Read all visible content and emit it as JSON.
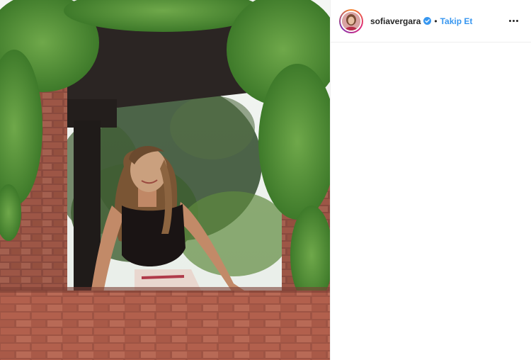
{
  "post": {
    "image_alt": "Woman in black top leaning on a brick wall under a pergola covered in ivy"
  },
  "header": {
    "username": "sofiavergara",
    "verified_icon": "verified-badge-icon",
    "separator": "•",
    "follow_label": "Takip Et",
    "more_icon": "more-options-icon"
  },
  "colors": {
    "follow_link": "#3897f0",
    "verified_badge": "#3897f0",
    "text": "#262626"
  }
}
